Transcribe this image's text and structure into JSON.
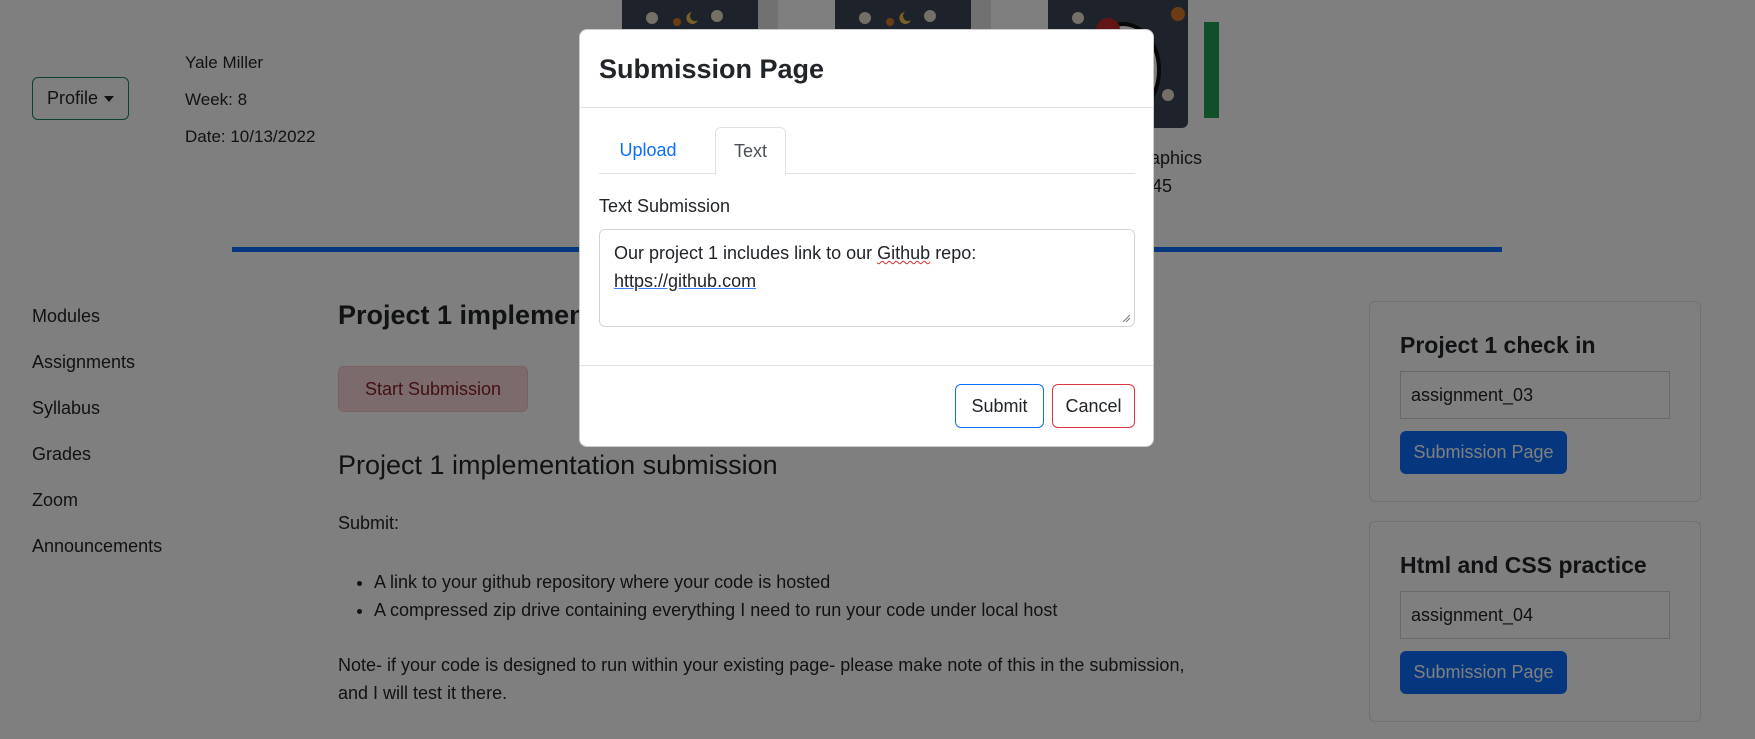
{
  "header": {
    "profile_button_label": "Profile",
    "user_name": "Yale Miller",
    "week": "Week: 8",
    "date": "Date: 10/13/2022"
  },
  "course_cards": {
    "third_card_title_fragment": "aphics",
    "third_card_subtitle_fragment": "45"
  },
  "sidebar": {
    "items": [
      {
        "label": "Modules"
      },
      {
        "label": "Assignments"
      },
      {
        "label": "Syllabus"
      },
      {
        "label": "Grades"
      },
      {
        "label": "Zoom"
      },
      {
        "label": "Announcements"
      }
    ]
  },
  "main": {
    "title_fragment": "Project 1 implemen",
    "start_submission_label": "Start Submission",
    "subtitle": "Project 1 implementation submission",
    "submit_label": "Submit:",
    "bullets": [
      "A link to your github repository where your code is hosted",
      "A compressed zip drive containing everything I need to run your code under local host"
    ],
    "note_line1": "Note- if your code is designed to run within your existing page- please make note of this in the submission,",
    "note_line2": "and I will test it there."
  },
  "right_panel": {
    "cards": [
      {
        "title": "Project 1 check in",
        "input_value": "assignment_03",
        "button_label": "Submission Page"
      },
      {
        "title": "Html and CSS practice",
        "input_value": "assignment_04",
        "button_label": "Submission Page"
      }
    ]
  },
  "modal": {
    "title": "Submission Page",
    "tabs": [
      {
        "label": "Upload"
      },
      {
        "label": "Text"
      }
    ],
    "active_tab": "Text",
    "field_label": "Text Submission",
    "textarea_value": {
      "part1": "Our project 1 includes link to our ",
      "misspelled_word": "Github",
      "part2": " repo:",
      "link": "https://github.com"
    },
    "submit_label": "Submit",
    "cancel_label": "Cancel"
  },
  "colors": {
    "primary": "#0d6efd",
    "success": "#198754",
    "danger": "#dc3545",
    "danger_light": "#f8d7da",
    "backdrop": "rgba(0,0,0,0.5)"
  }
}
